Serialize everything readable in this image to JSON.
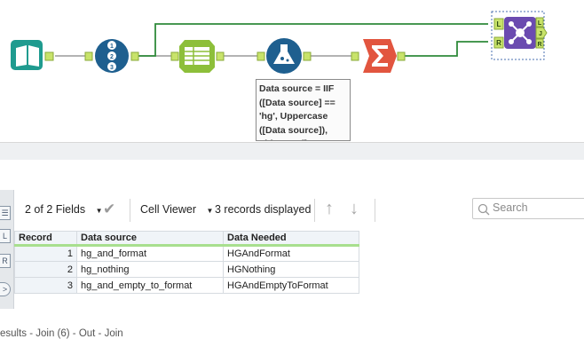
{
  "canvas": {
    "join_anchors": {
      "left_top": "L",
      "left_bottom": "R",
      "right_mid": "J",
      "right_top": "L",
      "right_bottom": "R"
    },
    "formula_note": "Data source = IIF ([Data source] == 'hg', Uppercase ([Data source]), TitleCase([Da",
    "colors": {
      "connector": "#2f8a3a",
      "connector_gray": "#9a9a9a",
      "input_tool": "#1f9b8f",
      "record_tool": "#1e5f8f",
      "select_tool": "#8dbf3a",
      "formula_tool": "#1e5f8f",
      "summarize_tool": "#e2553f",
      "join_tool": "#6b4bb0"
    }
  },
  "results": {
    "title": "esults - Join (6) - Out - Join",
    "fields_label": "2 of 2 Fields",
    "cell_viewer_label": "Cell Viewer",
    "records_label": "3 records displayed",
    "search_placeholder": "Search",
    "side_buttons": [
      "L",
      "R"
    ],
    "columns": [
      "Record",
      "Data source",
      "Data Needed"
    ],
    "rows": [
      {
        "record": "1",
        "data_source": "hg_and_format",
        "data_needed": "HGAndFormat"
      },
      {
        "record": "2",
        "data_source": "hg_nothing",
        "data_needed": "HGNothing"
      },
      {
        "record": "3",
        "data_source": "hg_and_empty_to_format",
        "data_needed": "HGAndEmptyToFormat"
      }
    ]
  }
}
